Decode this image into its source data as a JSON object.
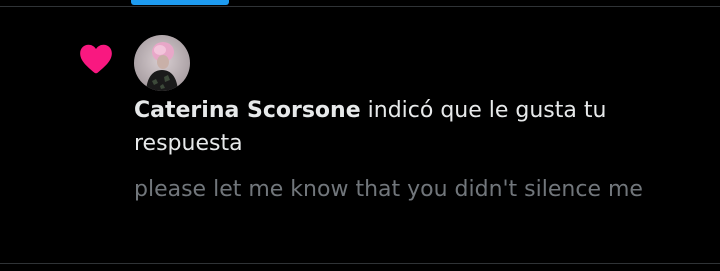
{
  "notification": {
    "user_name": "Caterina Scorsone",
    "action_text": " indicó que le gusta tu respuesta",
    "reply_text": "please let me know that you didn't silence me",
    "icon": "heart-icon",
    "avatar": "avatar"
  },
  "colors": {
    "background": "#000000",
    "heart": "#f91880",
    "tab_indicator": "#1d9bf0",
    "divider": "#2f3336",
    "primary_text": "#e7e9ea",
    "secondary_text": "#71767b"
  }
}
